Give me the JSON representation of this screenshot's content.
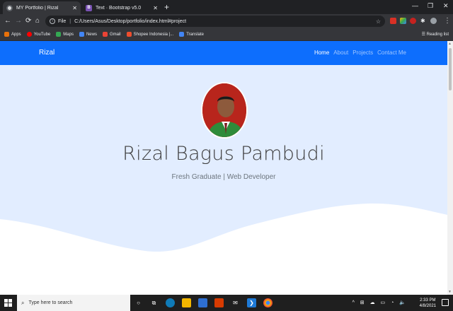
{
  "browser": {
    "tabs": [
      {
        "title": "MY Portfolio | Rizal",
        "active": true
      },
      {
        "title": "Text · Bootstrap v5.0",
        "active": false
      }
    ],
    "new_tab_icon": "plus-icon",
    "address": {
      "scheme": "File",
      "url": "C:/Users/Asus/Desktop/portfolio/index.html#project"
    },
    "bookmarks": [
      {
        "label": "Apps",
        "icon": "apps-grid-icon",
        "color": "#e8710a"
      },
      {
        "label": "YouTube",
        "icon": "youtube-icon",
        "color": "#ff0000"
      },
      {
        "label": "Maps",
        "icon": "maps-icon",
        "color": "#34a853"
      },
      {
        "label": "News",
        "icon": "news-icon",
        "color": "#4285f4"
      },
      {
        "label": "Gmail",
        "icon": "gmail-icon",
        "color": "#ea4335"
      },
      {
        "label": "Shopee Indonesia |...",
        "icon": "shopee-icon",
        "color": "#ee4d2d"
      },
      {
        "label": "Translate",
        "icon": "translate-icon",
        "color": "#4285f4"
      }
    ],
    "reading_list": "Reading list"
  },
  "page": {
    "brand": "Rizal",
    "nav": [
      {
        "label": "Home",
        "active": true
      },
      {
        "label": "About",
        "active": false
      },
      {
        "label": "Projects",
        "active": false
      },
      {
        "label": "Contact Me",
        "active": false
      }
    ],
    "hero": {
      "name": "Rizal Bagus Pambudi",
      "tagline": "Fresh Graduate | Web Developer"
    },
    "colors": {
      "navbar": "#0d6efd",
      "hero_bg": "#e2edff",
      "wave": "#ffffff"
    }
  },
  "taskbar": {
    "search_placeholder": "Type here to search",
    "time": "2:33 PM",
    "date": "4/8/2021"
  }
}
